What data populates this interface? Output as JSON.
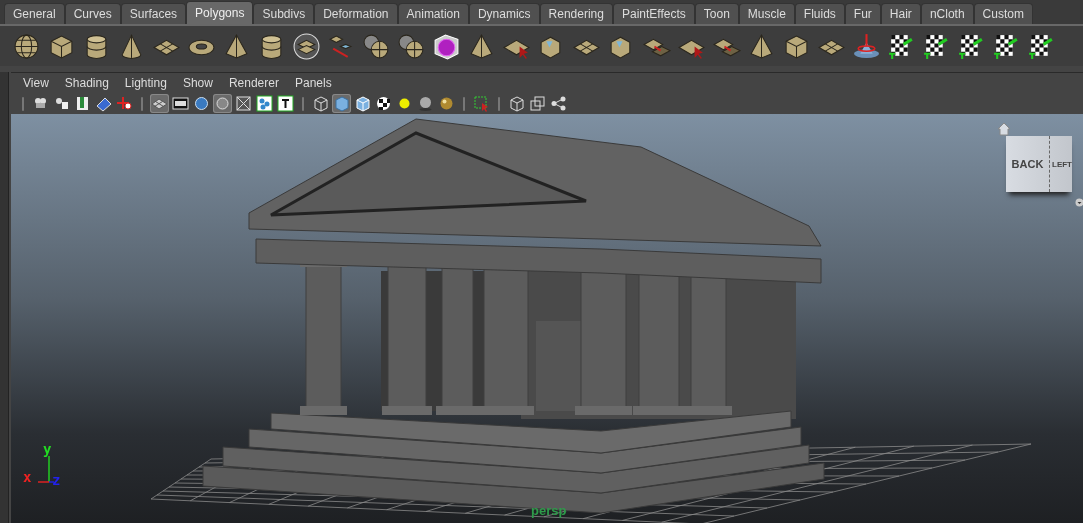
{
  "shelf_tabs": [
    {
      "label": "General",
      "selected": false
    },
    {
      "label": "Curves",
      "selected": false
    },
    {
      "label": "Surfaces",
      "selected": false
    },
    {
      "label": "Polygons",
      "selected": true
    },
    {
      "label": "Subdivs",
      "selected": false
    },
    {
      "label": "Deformation",
      "selected": false
    },
    {
      "label": "Animation",
      "selected": false
    },
    {
      "label": "Dynamics",
      "selected": false
    },
    {
      "label": "Rendering",
      "selected": false
    },
    {
      "label": "PaintEffects",
      "selected": false
    },
    {
      "label": "Toon",
      "selected": false
    },
    {
      "label": "Muscle",
      "selected": false
    },
    {
      "label": "Fluids",
      "selected": false
    },
    {
      "label": "Fur",
      "selected": false
    },
    {
      "label": "Hair",
      "selected": false
    },
    {
      "label": "nCloth",
      "selected": false
    },
    {
      "label": "Custom",
      "selected": false
    }
  ],
  "panel_menu": [
    "View",
    "Shading",
    "Lighting",
    "Show",
    "Renderer",
    "Panels"
  ],
  "panel_toolbar": [
    {
      "pressed": false
    },
    {
      "pressed": false
    },
    {
      "pressed": false
    },
    {
      "pressed": false
    },
    {
      "pressed": false
    },
    {
      "pressed": true
    },
    {
      "pressed": false
    },
    {
      "pressed": false
    },
    {
      "pressed": true
    },
    {
      "pressed": false
    },
    {
      "pressed": false
    },
    {
      "pressed": false
    },
    {
      "pressed": false
    },
    {
      "pressed": true
    },
    {
      "pressed": false
    },
    {
      "pressed": false
    },
    {
      "pressed": false
    },
    {
      "pressed": false
    },
    {
      "pressed": false
    },
    {
      "pressed": false
    },
    {
      "pressed": false
    },
    {
      "pressed": false
    },
    {
      "pressed": false
    }
  ],
  "view_cube": {
    "front": "BACK",
    "side": "LEFT"
  },
  "axis": {
    "x": "x",
    "y": "y",
    "z": "z"
  },
  "camera_label": "persp"
}
